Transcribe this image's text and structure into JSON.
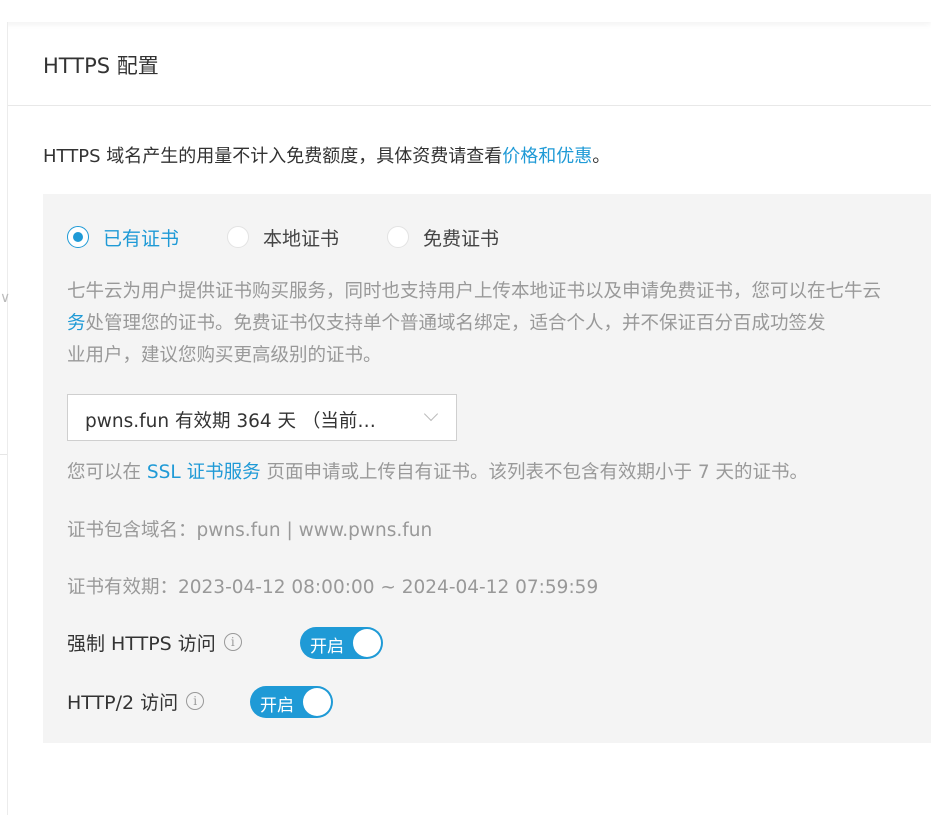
{
  "card": {
    "title": "HTTPS 配置"
  },
  "notice": {
    "text": "HTTPS 域名产生的用量不计入免费额度，具体资费请查看",
    "link": "价格和优惠",
    "end": "。"
  },
  "cert_source": {
    "options": [
      {
        "label": "已有证书",
        "selected": true
      },
      {
        "label": "本地证书",
        "selected": false
      },
      {
        "label": "免费证书",
        "selected": false
      }
    ]
  },
  "description": {
    "line1": "七牛云为用户提供证书购买服务，同时也支持用户上传本地证书以及申请免费证书，您可以在七牛云",
    "line2_link": "务",
    "line2_text": "处管理您的证书。免费证书仅支持单个普通域名绑定，适合个人，并不保证百分百成功签发",
    "line3": "业用户，建议您购买更高级别的证书。"
  },
  "cert_select": {
    "value": "pwns.fun 有效期 364 天 （当前…"
  },
  "hint": {
    "prefix": "您可以在 ",
    "link": "SSL 证书服务",
    "suffix": " 页面申请或上传自有证书。该列表不包含有效期小于 7 天的证书。"
  },
  "cert_domains": "证书包含域名：pwns.fun | www.pwns.fun",
  "cert_validity": "证书有效期：2023-04-12 08:00:00 ~ 2024-04-12 07:59:59",
  "force_https": {
    "label": "强制 HTTPS 访问",
    "icon": "info-icon",
    "switch_text": "开启",
    "on": true
  },
  "http2": {
    "label": "HTTP/2 访问",
    "icon": "info-icon",
    "switch_text": "开启",
    "on": true
  },
  "colors": {
    "accent": "#1f9ad6",
    "panel_bg": "#f4f4f4",
    "muted_text": "#999999"
  }
}
